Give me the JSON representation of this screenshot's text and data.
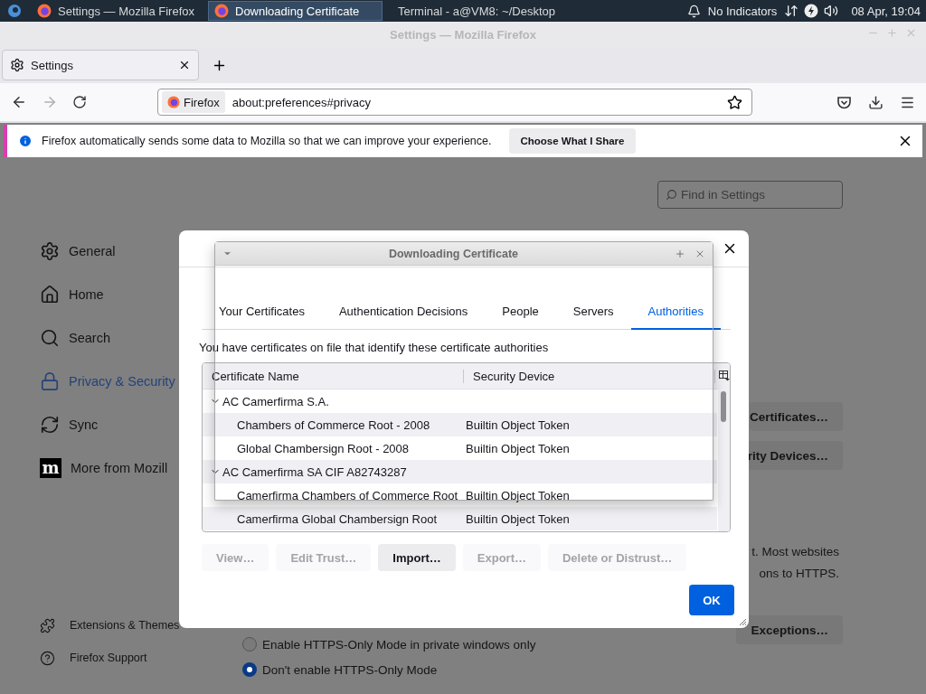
{
  "taskbar": {
    "tasks": [
      {
        "label": "Settings — Mozilla Firefox",
        "kind": "firefox",
        "selected": false
      },
      {
        "label": "Downloading Certificate",
        "kind": "firefox",
        "selected": true
      },
      {
        "label": "Terminal - a@VM8: ~/Desktop",
        "kind": "terminal",
        "selected": false
      }
    ],
    "indicator_label": "No Indicators",
    "clock": "08 Apr, 19:04"
  },
  "window": {
    "title": "Settings — Mozilla Firefox"
  },
  "tabs": [
    {
      "label": "Settings",
      "selected": true
    }
  ],
  "navbar": {
    "identity": "Firefox",
    "url": "about:preferences#privacy",
    "forward_disabled": true
  },
  "notification": {
    "message": "Firefox automatically sends some data to Mozilla so that we can improve your experience.",
    "button": "Choose What I Share"
  },
  "search": {
    "placeholder": "Find in Settings"
  },
  "sidebar": {
    "items": [
      {
        "label": "General",
        "selected": false
      },
      {
        "label": "Home",
        "selected": false
      },
      {
        "label": "Search",
        "selected": false
      },
      {
        "label": "Privacy & Security",
        "selected": true
      },
      {
        "label": "Sync",
        "selected": false
      },
      {
        "label": "More from Mozill",
        "logo_text": "m",
        "selected": false
      }
    ],
    "footer": [
      {
        "label": "Extensions & Themes"
      },
      {
        "label": "Firefox Support"
      }
    ]
  },
  "settings_page": {
    "buttons": [
      "Certificates…",
      "rity Devices…"
    ],
    "text_lines": [
      "t. Most websites",
      "ons to HTTPS."
    ],
    "exceptions_button": "Exceptions…",
    "radios": [
      {
        "label": "Enable HTTPS-Only Mode in private windows only",
        "selected": false
      },
      {
        "label": "Don't enable HTTPS-Only Mode",
        "selected": true
      }
    ]
  },
  "dialog": {
    "tabs": [
      {
        "label": "Your Certificates",
        "selected": false
      },
      {
        "label": "Authentication Decisions",
        "selected": false
      },
      {
        "label": "People",
        "selected": false
      },
      {
        "label": "Servers",
        "selected": false
      },
      {
        "label": "Authorities",
        "selected": true
      }
    ],
    "description": "You have certificates on file that identify these certificate authorities",
    "columns": [
      "Certificate Name",
      "Security Device"
    ],
    "tree": [
      {
        "name": "AC Camerfirma S.A.",
        "expanded": true,
        "children": [
          {
            "name": "Chambers of Commerce Root - 2008",
            "device": "Builtin Object Token"
          },
          {
            "name": "Global Chambersign Root - 2008",
            "device": "Builtin Object Token"
          }
        ]
      },
      {
        "name": "AC Camerfirma SA CIF A82743287",
        "expanded": true,
        "children": [
          {
            "name": "Camerfirma Chambers of Commerce Root",
            "device": "Builtin Object Token"
          },
          {
            "name": "Camerfirma Global Chambersign Root",
            "device": "Builtin Object Token"
          }
        ]
      }
    ],
    "buttons": [
      {
        "label": "View…",
        "disabled": true
      },
      {
        "label": "Edit Trust…",
        "disabled": true
      },
      {
        "label": "Import…",
        "disabled": false
      },
      {
        "label": "Export…",
        "disabled": true
      },
      {
        "label": "Delete or Distrust…",
        "disabled": true
      }
    ],
    "ok": "OK"
  },
  "popup_window": {
    "title": "Downloading Certificate"
  }
}
